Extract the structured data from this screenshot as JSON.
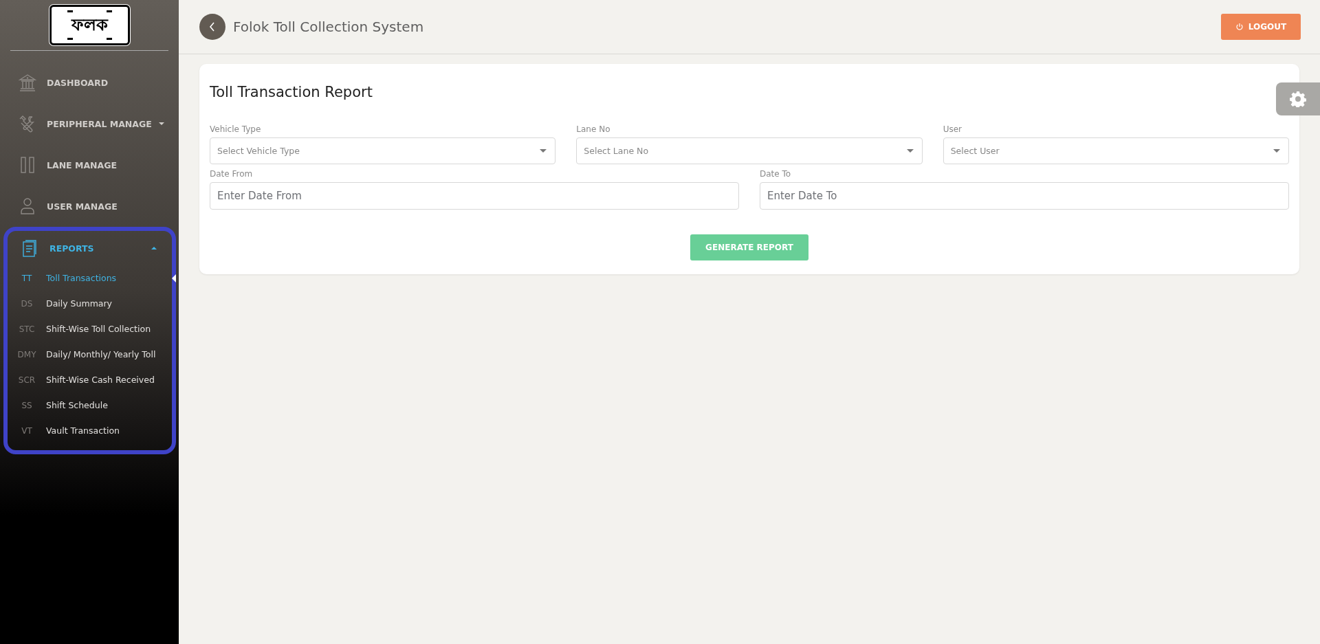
{
  "logo": {
    "text": "ফলক"
  },
  "sidebar": {
    "items": [
      {
        "label": "DASHBOARD",
        "kind": "bank",
        "selected": false
      },
      {
        "label": "PERIPHERAL MANAGE",
        "kind": "tools",
        "selected": false,
        "expanded": false
      },
      {
        "label": "LANE MANAGE",
        "kind": "columns",
        "selected": false
      },
      {
        "label": "USER MANAGE",
        "kind": "user",
        "selected": false
      },
      {
        "label": "REPORTS",
        "kind": "document",
        "selected": true,
        "expanded": true,
        "highlighted": true,
        "children": [
          {
            "abbr": "TT",
            "label": "Toll Transactions",
            "selected": true
          },
          {
            "abbr": "DS",
            "label": "Daily Summary",
            "selected": false
          },
          {
            "abbr": "STC",
            "label": "Shift-Wise Toll Collection",
            "selected": false
          },
          {
            "abbr": "DMY",
            "label": "Daily/ Monthly/ Yearly Toll",
            "selected": false
          },
          {
            "abbr": "SCR",
            "label": "Shift-Wise Cash Received",
            "selected": false
          },
          {
            "abbr": "SS",
            "label": "Shift Schedule",
            "selected": false
          },
          {
            "abbr": "VT",
            "label": "Vault Transaction",
            "selected": false
          }
        ]
      }
    ]
  },
  "header": {
    "title": "Folok Toll Collection System",
    "logout": "LOGOUT"
  },
  "card": {
    "title": "Toll Transaction Report",
    "rows": [
      [
        {
          "kind": "select",
          "label": "Vehicle Type",
          "placeholder": "Select Vehicle Type"
        },
        {
          "kind": "select",
          "label": "Lane No",
          "placeholder": "Select Lane No"
        },
        {
          "kind": "select",
          "label": "User",
          "placeholder": "Select User"
        }
      ],
      [
        {
          "kind": "input",
          "label": "Date From",
          "placeholder": "Enter Date From"
        },
        {
          "kind": "input",
          "label": "Date To",
          "placeholder": "Enter Date To"
        }
      ]
    ],
    "button": "GENERATE REPORT"
  }
}
